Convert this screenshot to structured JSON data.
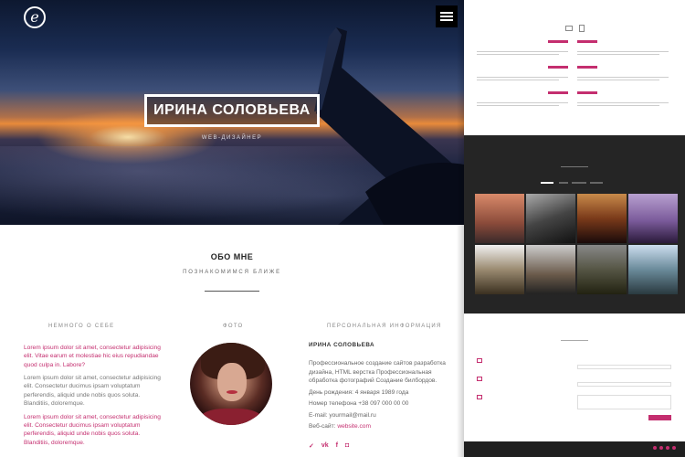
{
  "hero": {
    "logo_glyph": "e",
    "title": "ИРИНА СОЛОВЬЕВА",
    "subtitle": "WEB-ДИЗАЙНЕР"
  },
  "about": {
    "heading": "ОБО МНЕ",
    "subheading": "ПОЗНАКОМИМСЯ БЛИЖЕ",
    "col1_title": "НЕМНОГО О СЕБЕ",
    "col2_title": "ФОТО",
    "col3_title": "ПЕРСОНАЛЬНАЯ ИНФОРМАЦИЯ",
    "paragraphs": [
      "Lorem ipsum dolor sit amet, consectetur adipisicing elit. Vitae earum et molestiae hic eius repudiandae quod culpa in. Labore?",
      "Lorem ipsum dolor sit amet, consectetur adipisicing elit. Consectetur ducimus ipsam voluptatum perferendis, aliquid unde nobis quos soluta. Blanditiis, doloremque.",
      "Lorem ipsum dolor sit amet, consectetur adipisicing elit. Consectetur ducimus ipsam voluptatum perferendis, aliquid unde nobis quos soluta. Blanditiis, doloremque."
    ],
    "name": "ИРИНА СОЛОВЬЕВА",
    "skills": "Профессиональное создание сайтов разработка дизайна, HTML верстка Профессиональная обработка фотографий Создание билбордов.",
    "birthday": "День рождения: 4 января 1989 года",
    "phone": "Номер телефона +38 097 000 00 00",
    "email": "E-mail: yourmail@mail.ru",
    "website_label": "Веб-сайт:",
    "website": "website.com",
    "social": [
      "t",
      "vk",
      "f",
      "ig"
    ]
  },
  "accent": "#c42e6f"
}
